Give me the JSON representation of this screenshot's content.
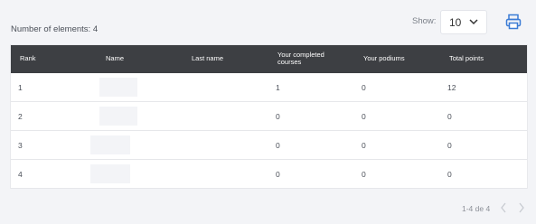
{
  "summary": {
    "count_text": "Number of elements: 4"
  },
  "page_size": {
    "label": "Show:",
    "value": "10"
  },
  "columns": [
    "Rank",
    "Name",
    "Last name",
    "Your completed courses",
    "Your podiums",
    "Total points"
  ],
  "columns_wrapped": {
    "courses_line1": "Your completed",
    "courses_line2": "courses"
  },
  "rows": [
    {
      "rank": "1",
      "completed": "1",
      "podiums": "0",
      "points": "12"
    },
    {
      "rank": "2",
      "completed": "0",
      "podiums": "0",
      "points": "0"
    },
    {
      "rank": "3",
      "completed": "0",
      "podiums": "0",
      "points": "0"
    },
    {
      "rank": "4",
      "completed": "0",
      "podiums": "0",
      "points": "0"
    }
  ],
  "pagination": {
    "text": "1-4 de 4"
  },
  "icons": {
    "print": "printer-icon",
    "dropdown": "chevron-down-icon",
    "prev": "chevron-left-icon",
    "next": "chevron-right-icon"
  },
  "colors": {
    "header_bg": "#3d3f43",
    "accent": "#3a7bd5"
  }
}
